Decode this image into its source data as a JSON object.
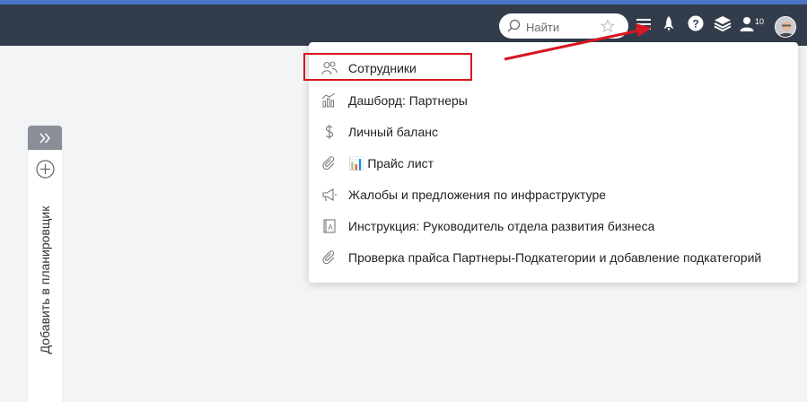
{
  "search": {
    "placeholder": "Найти"
  },
  "notifications": {
    "count": "10"
  },
  "menu": {
    "items": [
      {
        "icon": "users-icon",
        "label": "Сотрудники"
      },
      {
        "icon": "chart-icon",
        "label": "Дашборд: Партнеры"
      },
      {
        "icon": "dollar-icon",
        "label": "Личный баланс"
      },
      {
        "icon": "paperclip-icon",
        "label": "📊 Прайс лист"
      },
      {
        "icon": "megaphone-icon",
        "label": "Жалобы и предложения по инфраструктуре"
      },
      {
        "icon": "book-icon",
        "label": "Инструкция: Руководитель отдела развития бизнеса"
      },
      {
        "icon": "paperclip-icon",
        "label": "Проверка прайса Партнеры-Подкатегории и добавление подкатегорий"
      }
    ]
  },
  "planner": {
    "label": "Добавить в планировщик"
  },
  "colors": {
    "topbar": "#323c4b",
    "topbar_accent": "#4a74c4",
    "annotation": "#d8171f"
  }
}
